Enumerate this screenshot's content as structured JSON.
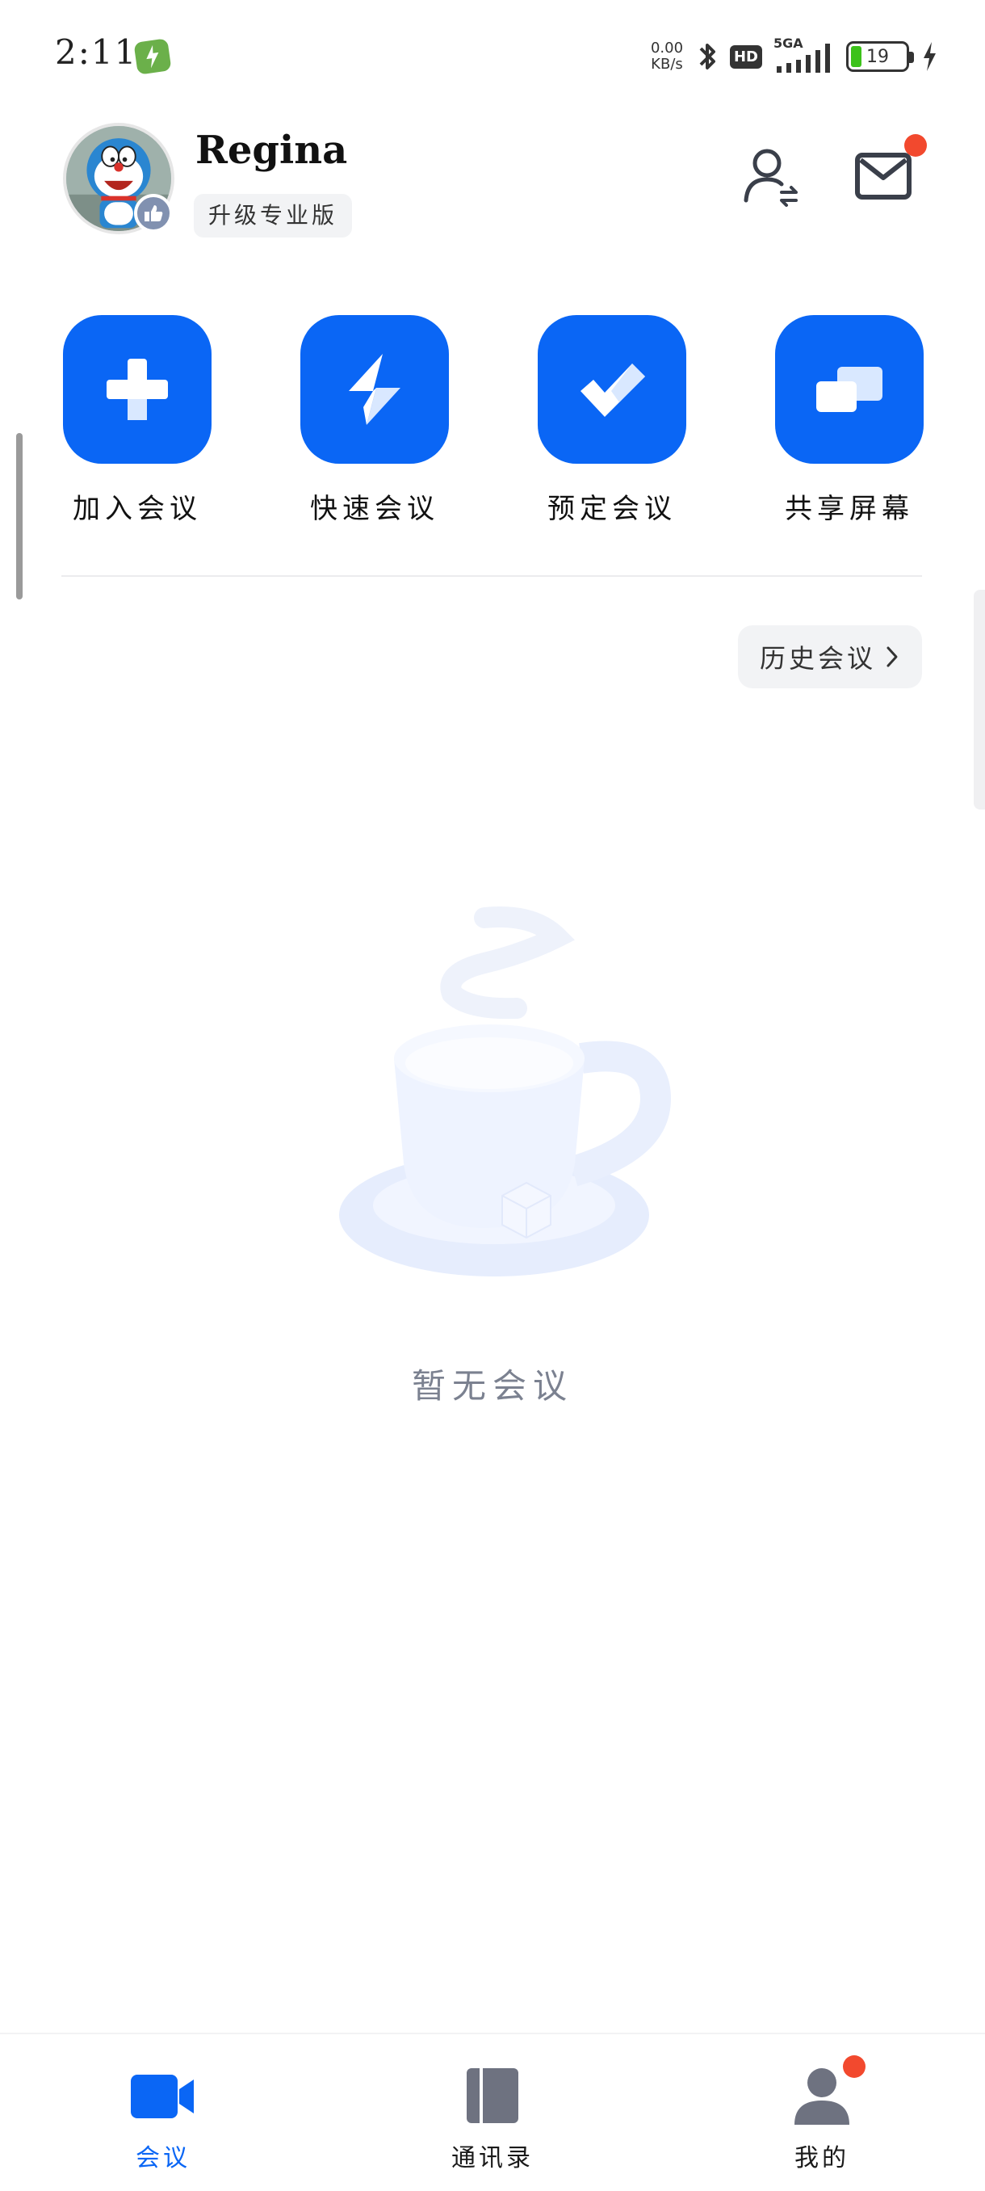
{
  "status_bar": {
    "time": "2:11",
    "net_speed_value": "0.00",
    "net_speed_unit": "KB/s",
    "hd_label": "HD",
    "network_label": "5GA",
    "battery_level": "19",
    "battery_fraction": 0.19
  },
  "profile": {
    "user_name": "Regina",
    "upgrade_label": "升级专业版"
  },
  "quick_actions": [
    {
      "label": "加入会议",
      "icon": "plus-icon"
    },
    {
      "label": "快速会议",
      "icon": "lightning-icon"
    },
    {
      "label": "预定会议",
      "icon": "check-icon"
    },
    {
      "label": "共享屏幕",
      "icon": "share-screen-icon"
    }
  ],
  "history": {
    "label": "历史会议"
  },
  "empty_state": {
    "text": "暂无会议",
    "icon": "coffee-cup-icon"
  },
  "bottom_nav": {
    "items": [
      {
        "label": "会议",
        "icon": "video-camera-icon",
        "active": true
      },
      {
        "label": "通讯录",
        "icon": "address-book-icon",
        "active": false
      },
      {
        "label": "我的",
        "icon": "person-icon",
        "active": false,
        "badge": true
      }
    ]
  },
  "colors": {
    "accent": "#0a66f5",
    "badge_red": "#f2492e",
    "inactive_icon": "#6e7280",
    "empty_text": "#7b8190"
  }
}
